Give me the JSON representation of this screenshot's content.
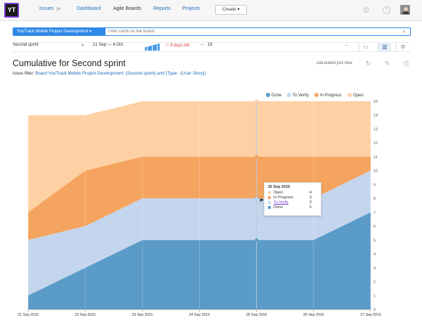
{
  "topbar": {
    "logo": "YT",
    "nav": [
      "Issues",
      "Dashboard",
      "Agile Boards",
      "Reports",
      "Projects"
    ],
    "create_label": "Create"
  },
  "board": {
    "name": "YouTrack Mobile Project Development",
    "filter_placeholder": "Filter cards on the board"
  },
  "sprint": {
    "name": "Second sprint",
    "dates": "21 Sep — 4 Oct",
    "days_left": "9 days left",
    "count_prefix": "—",
    "count": "16",
    "mini_bars": [
      0.5,
      0.6,
      0.7,
      0.8,
      0.9,
      1.0
    ]
  },
  "report": {
    "title": "Cumulative for Second sprint",
    "calculated": "calculated just now",
    "filter_label": "Issue filter:",
    "filter_value": "Board YouTrack Mobile Project Development: {Second sprint} and (Type: -{User Story})"
  },
  "colors": {
    "done": "#5b9bc8",
    "to_verify": "#c4d6ee",
    "in_progress": "#f5a45f",
    "open": "#fdd1a3"
  },
  "chart_data": {
    "type": "area",
    "stacked": true,
    "x": [
      "21 Sep 2015",
      "22 Sep 2015",
      "23 Sep 2015",
      "24 Sep 2015",
      "25 Sep 2015",
      "26 Sep 2015",
      "27 Sep 2015"
    ],
    "xlabel": "",
    "ylabel": "",
    "ylim": [
      0,
      15
    ],
    "yticks": [
      0,
      1,
      2,
      3,
      4,
      5,
      6,
      7,
      8,
      9,
      10,
      11,
      12,
      13,
      14,
      15
    ],
    "legend": "top-right",
    "series": [
      {
        "name": "Done",
        "color": "#5b9bc8",
        "values": [
          1,
          3,
          5,
          5,
          5,
          5,
          7
        ]
      },
      {
        "name": "To Verify",
        "color": "#c4d6ee",
        "values": [
          4,
          3,
          3,
          3,
          3,
          3,
          3
        ]
      },
      {
        "name": "In Progress",
        "color": "#f5a45f",
        "values": [
          2,
          4,
          3,
          3,
          3,
          3,
          1
        ]
      },
      {
        "name": "Open",
        "color": "#fdd1a3",
        "values": [
          7,
          4,
          4,
          4,
          4,
          4,
          4
        ]
      }
    ],
    "tooltip": {
      "date": "25 Sep 2015",
      "rows": [
        {
          "name": "Open",
          "value": "4"
        },
        {
          "name": "In Progress",
          "value": "3"
        },
        {
          "name": "To Verify",
          "value": "3"
        },
        {
          "name": "Done",
          "value": "5"
        }
      ]
    }
  }
}
